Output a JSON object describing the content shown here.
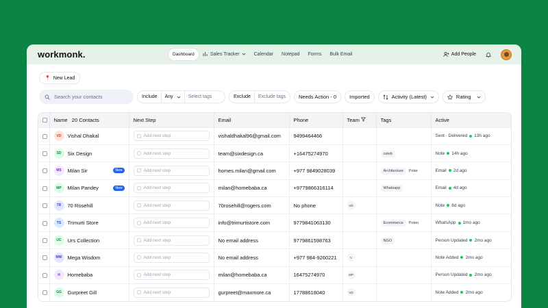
{
  "app": {
    "logo": "workmonk."
  },
  "nav": [
    {
      "label": "Dashboard",
      "active": true
    },
    {
      "label": "Sales Tracker",
      "dropdown": true
    },
    {
      "label": "Calendar"
    },
    {
      "label": "Notepad"
    },
    {
      "label": "Forms"
    },
    {
      "label": "Bulk Email"
    }
  ],
  "header_tools": {
    "add_people": "Add People"
  },
  "toolbar": {
    "new_lead": "New Lead"
  },
  "filters": {
    "search_placeholder": "Search your contacts",
    "include_label": "Include",
    "include_value": "Any",
    "include_tags_placeholder": "Select tags",
    "exclude_label": "Exclude",
    "exclude_tags_placeholder": "Exclude tags",
    "needs_action": "Needs Action - 0",
    "imported": "Imported",
    "sort": "Activity (Latest)",
    "rating": "Rating"
  },
  "table": {
    "headers": {
      "name": "Name",
      "count": "20 Contacts",
      "next_step": "Next Step",
      "email": "Email",
      "phone": "Phone",
      "team": "Team",
      "tags": "Tags",
      "active": "Active"
    },
    "next_step_placeholder": "Add next step",
    "new_badge": "New",
    "rows": [
      {
        "initials": "VD",
        "avatar_bg": "#fde4dc",
        "avatar_fg": "#c2410c",
        "name": "Vishal Dhakal",
        "new": false,
        "email": "vishaldhakal96@gmail.com",
        "phone": "9499464466",
        "team": "",
        "tags": [],
        "active_type": "Sent · Delivered",
        "active_time": "13h ago"
      },
      {
        "initials": "SD",
        "avatar_bg": "#dcfce7",
        "avatar_fg": "#15803d",
        "name": "Six Design",
        "new": false,
        "email": "team@sixdesign.ca",
        "phone": "+16475274970",
        "team": "",
        "tags": [
          "celeb"
        ],
        "active_type": "Note",
        "active_time": "14h ago"
      },
      {
        "initials": "MS",
        "avatar_bg": "#f3e8ff",
        "avatar_fg": "#7e22ce",
        "name": "Milan Sir",
        "new": true,
        "email": "homes.milan@gmail.com",
        "phone": "+977 9849028039",
        "team": "",
        "tags": [
          "Architecture",
          "Poter"
        ],
        "active_type": "Email",
        "active_time": "2d ago"
      },
      {
        "initials": "MP",
        "avatar_bg": "#dcfce7",
        "avatar_fg": "#15803d",
        "name": "Milan Pandey",
        "new": true,
        "email": "milan@homebaba.ca",
        "phone": "+9779866316114",
        "team": "",
        "tags": [
          "Whatsapp"
        ],
        "active_type": "Email",
        "active_time": "4d ago"
      },
      {
        "initials": "7R",
        "avatar_bg": "#e0e7ff",
        "avatar_fg": "#4338ca",
        "name": "70 Rosehill",
        "new": false,
        "email": "70rosehill@rogers.com",
        "phone": "No phone",
        "team": "VD",
        "tags": [],
        "active_type": "Note",
        "active_time": "8d ago"
      },
      {
        "initials": "TS",
        "avatar_bg": "#dbeafe",
        "avatar_fg": "#1d4ed8",
        "name": "Trimurti Store",
        "new": false,
        "email": "info@trimurtistore.com",
        "phone": "9779841063130",
        "team": "",
        "tags": [
          "Ecommerce",
          "Poten"
        ],
        "active_type": "WhatsApp",
        "active_time": "1mo ago"
      },
      {
        "initials": "UC",
        "avatar_bg": "#dcfce7",
        "avatar_fg": "#15803d",
        "name": "Urs Collection",
        "new": false,
        "email": "No email address",
        "phone": "9779861598763",
        "team": "",
        "tags": [
          "NGO"
        ],
        "active_type": "Person Updated",
        "active_time": "2mo ago"
      },
      {
        "initials": "MW",
        "avatar_bg": "#e0e7ff",
        "avatar_fg": "#4338ca",
        "name": "Mega Wisdom",
        "new": false,
        "email": "No email address",
        "phone": "+977 984-9260221",
        "team": "V",
        "tags": [],
        "active_type": "Note Added",
        "active_time": "2mo ago"
      },
      {
        "initials": "H",
        "avatar_bg": "#f3e8ff",
        "avatar_fg": "#7e22ce",
        "name": "Homebaba",
        "new": false,
        "email": "milan@homebaba.ca",
        "phone": "16475274970",
        "team": "MP",
        "tags": [],
        "active_type": "Person Updated",
        "active_time": "2mo ago"
      },
      {
        "initials": "GG",
        "avatar_bg": "#dcfce7",
        "avatar_fg": "#15803d",
        "name": "Gurpreet Gill",
        "new": false,
        "email": "gurpreet@maxmore.ca",
        "phone": "17788618040",
        "team": "VD",
        "tags": [],
        "active_type": "Note Added",
        "active_time": "2mo ago"
      }
    ]
  }
}
